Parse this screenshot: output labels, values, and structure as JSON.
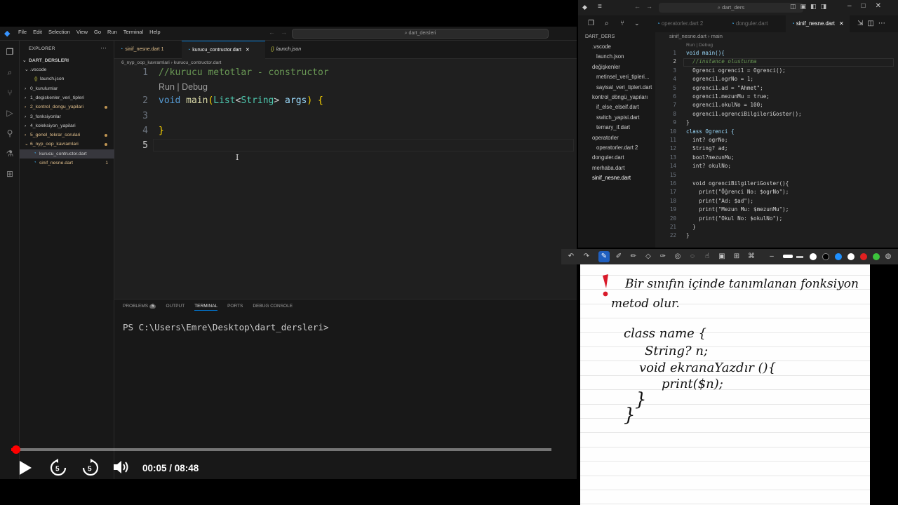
{
  "left_app": {
    "menu": [
      "File",
      "Edit",
      "Selection",
      "View",
      "Go",
      "Run",
      "Terminal",
      "Help"
    ],
    "search": "dart_dersleri",
    "explorer": {
      "title": "EXPLORER",
      "root": "DART_DERSLERI",
      "items": [
        {
          "label": ".vscode",
          "indent": 1,
          "twisty": "⌄",
          "color": "#cccccc"
        },
        {
          "label": "launch.json",
          "indent": 2,
          "icon": "{}",
          "color": "#cccccc"
        },
        {
          "label": "0_kurulumlar",
          "indent": 1,
          "twisty": "›",
          "color": "#cccccc"
        },
        {
          "label": "1_degiskenler_veri_tipleri",
          "indent": 1,
          "twisty": "›",
          "color": "#cccccc"
        },
        {
          "label": "2_kontrol_dongu_yapilari",
          "indent": 1,
          "twisty": "›",
          "color": "#e2c08d",
          "dot": true
        },
        {
          "label": "3_fonksiyonlar",
          "indent": 1,
          "twisty": "›",
          "color": "#cccccc"
        },
        {
          "label": "4_koleksiyon_yapilari",
          "indent": 1,
          "twisty": "›",
          "color": "#cccccc"
        },
        {
          "label": "5_genel_tekrar_sorulari",
          "indent": 1,
          "twisty": "›",
          "color": "#e2c08d",
          "dot": true
        },
        {
          "label": "6_nyp_oop_kavramlari",
          "indent": 1,
          "twisty": "⌄",
          "color": "#e2c08d",
          "dot": true
        },
        {
          "label": "kurucu_contructor.dart",
          "indent": 2,
          "color": "#cccccc",
          "selected": true
        },
        {
          "label": "sinif_nesne.dart",
          "indent": 2,
          "color": "#e2c08d",
          "num": "1"
        }
      ]
    },
    "tabs": [
      {
        "label": "sinif_nesne.dart 1",
        "color": "#e2c08d",
        "italic": false
      },
      {
        "label": "kurucu_contructor.dart",
        "color": "#ffffff",
        "active": true,
        "close": "✕"
      },
      {
        "label": "launch.json",
        "color": "#cccccc",
        "italic": true
      }
    ],
    "breadcrumb": "6_nyp_oop_kavramlari  ›  kurucu_contructor.dart",
    "code_lines": [
      {
        "no": "1",
        "text": "//kurucu metotlar - constructor"
      },
      {
        "no": "2",
        "text": "void main(List<String> args) {"
      },
      {
        "no": "3",
        "text": ""
      },
      {
        "no": "4",
        "text": "}"
      },
      {
        "no": "5",
        "text": ""
      }
    ],
    "codelens": "Run | Debug",
    "panel": {
      "tabs": [
        "PROBLEMS",
        "OUTPUT",
        "TERMINAL",
        "PORTS",
        "DEBUG CONSOLE"
      ],
      "problems_count": "5",
      "active": "TERMINAL",
      "prompt": "PS C:\\Users\\Emre\\Desktop\\dart_dersleri>"
    },
    "video": {
      "time": "00:05 / 08:48",
      "progress_fraction": 0.0095
    }
  },
  "right_app": {
    "title": "dart_ders",
    "tabs": [
      {
        "label": "operatorler.dart 2",
        "color": "#6a6a6a"
      },
      {
        "label": "donguler.dart",
        "color": "#6a6a6a"
      },
      {
        "label": "sinif_nesne.dart",
        "color": "#ffffff",
        "active": true
      }
    ],
    "breadcrumb": "sinif_nesne.dart  ›  main",
    "explorer": [
      {
        "label": "DART_DERS",
        "x": 10,
        "color": "#bbbbbb"
      },
      {
        "label": ".vscode",
        "x": 20,
        "color": "#cccccc"
      },
      {
        "label": "launch.json",
        "x": 26,
        "color": "#cccccc"
      },
      {
        "label": "değişkenler",
        "x": 20,
        "color": "#cccccc"
      },
      {
        "label": "metinsel_veri_tipleri...",
        "x": 26,
        "color": "#cccccc"
      },
      {
        "label": "sayisal_veri_tipleri.dart",
        "x": 26,
        "color": "#cccccc"
      },
      {
        "label": "kontrol_döngü_yapıları",
        "x": 20,
        "color": "#cccccc"
      },
      {
        "label": "if_else_elseif.dart",
        "x": 26,
        "color": "#cccccc"
      },
      {
        "label": "switch_yapisi.dart",
        "x": 26,
        "color": "#cccccc"
      },
      {
        "label": "ternary_if.dart",
        "x": 26,
        "color": "#cccccc"
      },
      {
        "label": "operatorler",
        "x": 20,
        "color": "#cccccc"
      },
      {
        "label": "operatorler.dart  2",
        "x": 26,
        "color": "#cccccc"
      },
      {
        "label": "donguler.dart",
        "x": 20,
        "color": "#cccccc"
      },
      {
        "label": "merhaba.dart",
        "x": 20,
        "color": "#cccccc"
      },
      {
        "label": "sinif_nesne.dart",
        "x": 20,
        "color": "#ffffff"
      }
    ],
    "codelens": "Run | Debug",
    "lines": [
      {
        "no": "1",
        "text": "void main(){"
      },
      {
        "no": "2",
        "text": "  //instance olusturma"
      },
      {
        "no": "3",
        "text": "  Ogrenci ogrenci1 = Ogrenci();"
      },
      {
        "no": "4",
        "text": "  ogrenci1.ogrNo = 1;"
      },
      {
        "no": "5",
        "text": "  ogrenci1.ad = \"Ahmet\";"
      },
      {
        "no": "6",
        "text": "  ogrenci1.mezunMu = true;"
      },
      {
        "no": "7",
        "text": "  ogrenci1.okulNo = 100;"
      },
      {
        "no": "8",
        "text": "  ogrenci1.ogrenciBilgileriGoster();"
      },
      {
        "no": "9",
        "text": "}"
      },
      {
        "no": "10",
        "text": "class Ogrenci {"
      },
      {
        "no": "11",
        "text": "  int? ogrNo;"
      },
      {
        "no": "12",
        "text": "  String? ad;"
      },
      {
        "no": "13",
        "text": "  bool?mezunMu;"
      },
      {
        "no": "14",
        "text": "  int? okulNo;"
      },
      {
        "no": "15",
        "text": ""
      },
      {
        "no": "16",
        "text": "  void ogrenciBilgileriGoster(){"
      },
      {
        "no": "17",
        "text": "    print(\"Öğrenci No: $ogrNo\");"
      },
      {
        "no": "18",
        "text": "    print(\"Ad: $ad\");"
      },
      {
        "no": "19",
        "text": "    print(\"Mezun Mu: $mezunMu\");"
      },
      {
        "no": "20",
        "text": "    print(\"Okul No: $okulNo\");"
      },
      {
        "no": "21",
        "text": "  }"
      },
      {
        "no": "22",
        "text": "}"
      }
    ]
  },
  "notes": {
    "line1": "Bir sınıfın içinde tanımlanan fonksiyon",
    "line2": "metod olur.",
    "code1": "class name {",
    "code2": "String? n;",
    "code3": "void ekranaYazdır (){",
    "code4": "print($n);",
    "code5": "}",
    "code6": "}",
    "pen_colors": [
      "#ffffff",
      "#000000",
      "#1e90ff",
      "#ffffff",
      "#e02020",
      "#3cc43c"
    ]
  }
}
